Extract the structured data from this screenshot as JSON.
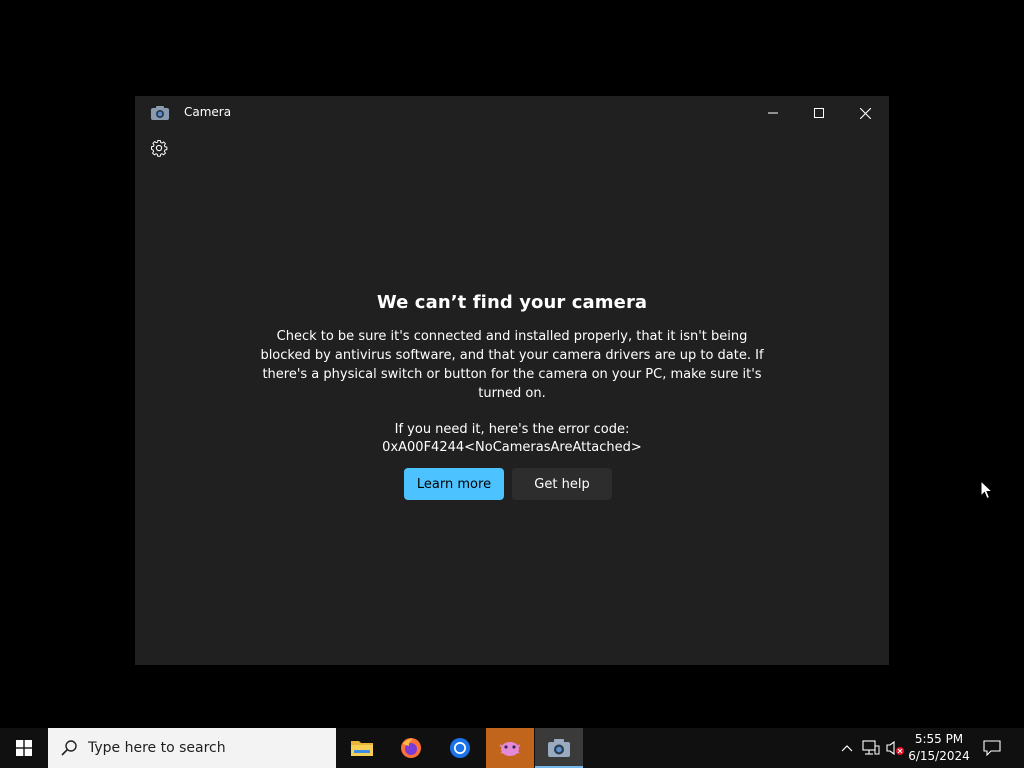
{
  "window": {
    "title": "Camera",
    "minimize_icon": "minimize-icon",
    "maximize_icon": "maximize-icon",
    "close_icon": "close-icon",
    "settings_icon": "gear-icon"
  },
  "error": {
    "heading": "We can’t find your camera",
    "message": "Check to be sure it's connected and installed properly, that it isn't being blocked by antivirus software, and that your camera drivers are up to date. If there's a physical switch or button for the camera on your PC, make sure it's turned on.",
    "code_label": "If you need it, here's the error code:",
    "code": "0xA00F4244<NoCamerasAreAttached>"
  },
  "buttons": {
    "learn_more": "Learn more",
    "get_help": "Get help"
  },
  "taskbar": {
    "search_placeholder": "Type here to search",
    "apps": [
      "file-explorer-icon",
      "firefox-icon",
      "chrome-icon",
      "paint-icon",
      "camera-icon"
    ],
    "time": "5:55 PM",
    "date": "6/15/2024"
  },
  "colors": {
    "accent": "#4cc2ff",
    "window_bg": "#202020",
    "desktop_bg": "#000000"
  }
}
